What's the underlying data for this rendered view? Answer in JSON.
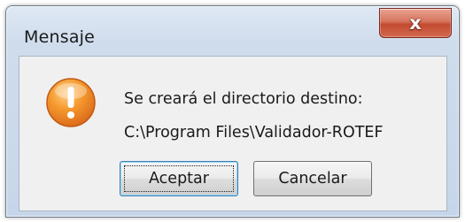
{
  "window": {
    "title": "Mensaje"
  },
  "titlebar": {
    "close_icon": "close-icon",
    "close_glyph": "x"
  },
  "message": {
    "icon": "warning-icon",
    "line1": "Se creará el directorio destino:",
    "line2": "C:\\Program Files\\Validador-ROTEF"
  },
  "buttons": {
    "accept_label": "Aceptar",
    "cancel_label": "Cancelar"
  },
  "colors": {
    "warning_icon": "#f08a24",
    "close_button": "#c24a30",
    "dialog_body": "#f0f0f0",
    "focus_border": "#3c7fb1"
  }
}
